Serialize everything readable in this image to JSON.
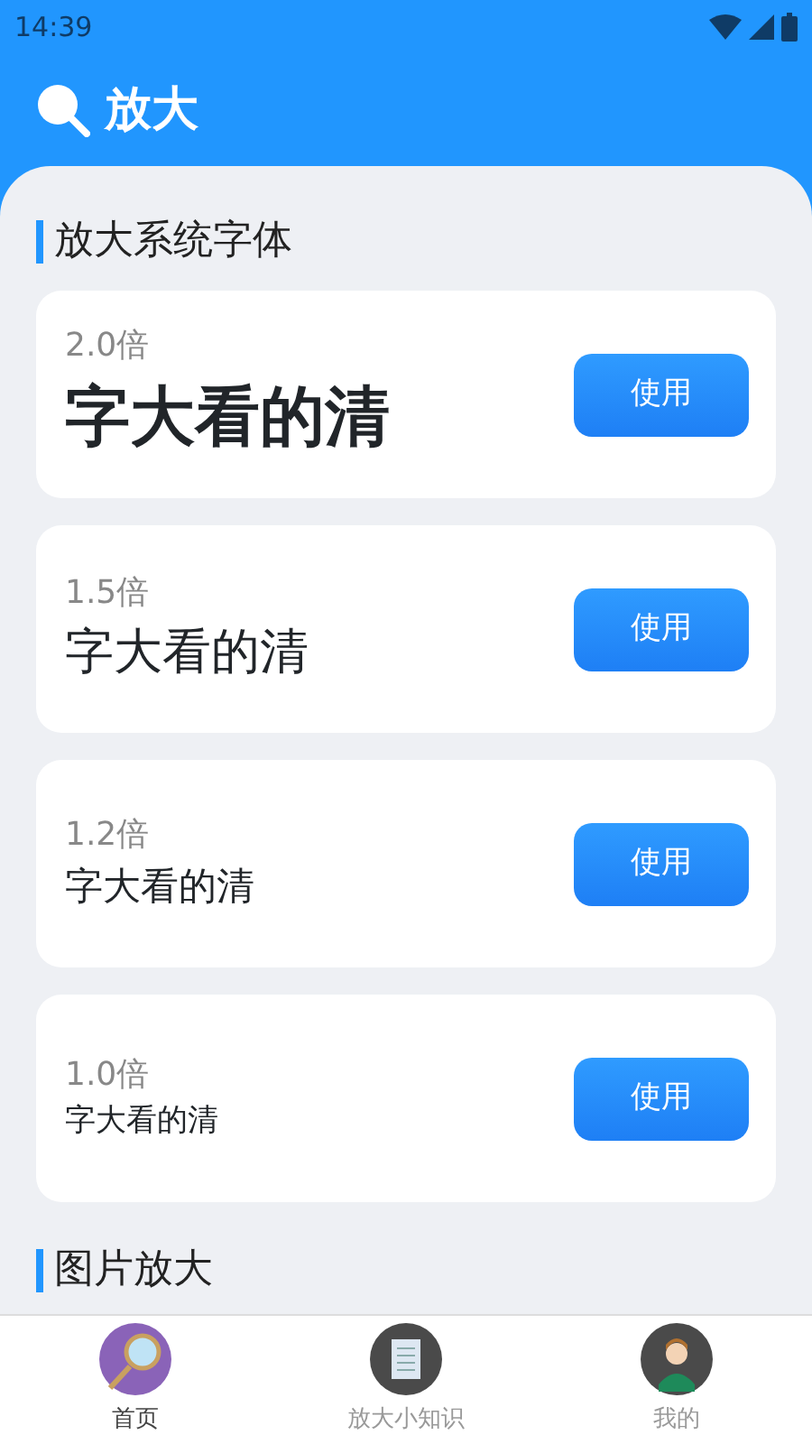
{
  "status_bar": {
    "time": "14:39"
  },
  "header": {
    "title": "放大"
  },
  "sections": [
    {
      "title": "放大系统字体"
    },
    {
      "title": "图片放大"
    }
  ],
  "font_options": [
    {
      "scale": "2.0倍",
      "sample": "字大看的清",
      "button": "使用"
    },
    {
      "scale": "1.5倍",
      "sample": "字大看的清",
      "button": "使用"
    },
    {
      "scale": "1.2倍",
      "sample": "字大看的清",
      "button": "使用"
    },
    {
      "scale": "1.0倍",
      "sample": "字大看的清",
      "button": "使用"
    }
  ],
  "bottom_nav": [
    {
      "label": "首页",
      "selected": true
    },
    {
      "label": "放大小知识",
      "selected": false
    },
    {
      "label": "我的",
      "selected": false
    }
  ]
}
